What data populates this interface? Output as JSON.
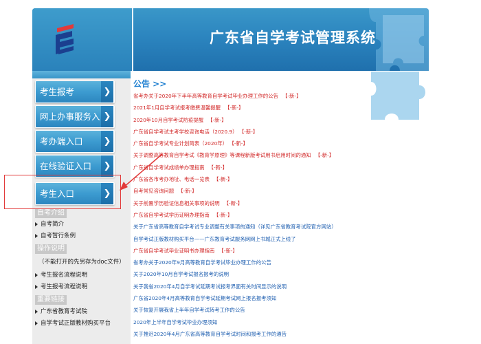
{
  "header": {
    "title": "广东省自学考试管理系统"
  },
  "sidebar": {
    "buttons": [
      {
        "label": "考生报考"
      },
      {
        "label": "网上办事服务入口"
      },
      {
        "label": "考办端入口"
      },
      {
        "label": "在线验证入口"
      },
      {
        "label": "考生入口"
      }
    ],
    "sections": [
      {
        "heading": "自考介绍",
        "links": [
          "自考简介",
          "自考暂行条例"
        ]
      },
      {
        "heading": "操作说明",
        "links": [
          "（不能打开的先另存为doc文件）",
          "考生报名流程说明",
          "考生报考流程说明"
        ]
      },
      {
        "heading": "重要链接",
        "links": [
          "广东省教育考试院",
          "自学考试正版教材购买平台"
        ]
      }
    ]
  },
  "main": {
    "notice_title": "公告 >>",
    "new_tag": "【-新-】",
    "notices": [
      {
        "text": "省考办关于2020年下半年高等教育自学考试毕业办理工作的公告",
        "new": true,
        "color": "red"
      },
      {
        "text": "2021年1月自学考试报考缴费温馨提醒",
        "new": true,
        "color": "red"
      },
      {
        "text": "2020年10月自学考试防疫提醒",
        "new": true,
        "color": "red"
      },
      {
        "text": "广东省自学考试主考学校咨询电话（2020.9）",
        "new": true,
        "color": "red"
      },
      {
        "text": "广东省自学考试专业计划简表（2020年）",
        "new": true,
        "color": "red"
      },
      {
        "text": "关于调整高等教育自学考试《教育学原理》等课程新版考试用书启用时间的通知",
        "new": true,
        "color": "red"
      },
      {
        "text": "广东省自学考试成绩单办理指南",
        "new": true,
        "color": "red"
      },
      {
        "text": "广东省各市考办地址、电话一览表",
        "new": true,
        "color": "red"
      },
      {
        "text": "自考常见咨询问题",
        "new": true,
        "color": "red"
      },
      {
        "text": "关于前置学历验证信息相关事项的说明",
        "new": true,
        "color": "red"
      },
      {
        "text": "广东省自学考试学历证明办理指南",
        "new": true,
        "color": "red"
      },
      {
        "text": "关于广东省高等教育自学考试专业调整有关事项的通知（详见广东省教育考试院官方网站）",
        "new": false,
        "color": "blue"
      },
      {
        "text": "自学考试正版教材购买平台——广东教育考试服务网网上书城正式上线了",
        "new": false,
        "color": "blue"
      },
      {
        "text": "广东省自学考试毕业证明书办理指南",
        "new": true,
        "color": "red"
      },
      {
        "text": "省考办关于2020年9月高等教育自学考试毕业办理工作的公告",
        "new": false,
        "color": "blue"
      },
      {
        "text": "关于2020年10月自学考试报名报考的说明",
        "new": false,
        "color": "blue"
      },
      {
        "text": "关于我省2020年4月自学考试延期考试报考界面有关时间显示的说明",
        "new": false,
        "color": "blue"
      },
      {
        "text": "广东省2020年4月高等教育自学考试延期考试网上报名报考须知",
        "new": false,
        "color": "blue"
      },
      {
        "text": "关于恢复开展我省上半年自学考试转考工作的公告",
        "new": false,
        "color": "blue"
      },
      {
        "text": "2020年上半年自学考试毕业办理须知",
        "new": false,
        "color": "blue"
      },
      {
        "text": "关于推迟2020年4月广东省高等教育自学考试时间和报考工作的通告",
        "new": false,
        "color": "blue"
      }
    ]
  },
  "colors": {
    "header_blue": "#2c85bf",
    "notice_red": "#d22a2a",
    "notice_blue": "#1f5fb0",
    "highlight": "#e23a3a"
  }
}
